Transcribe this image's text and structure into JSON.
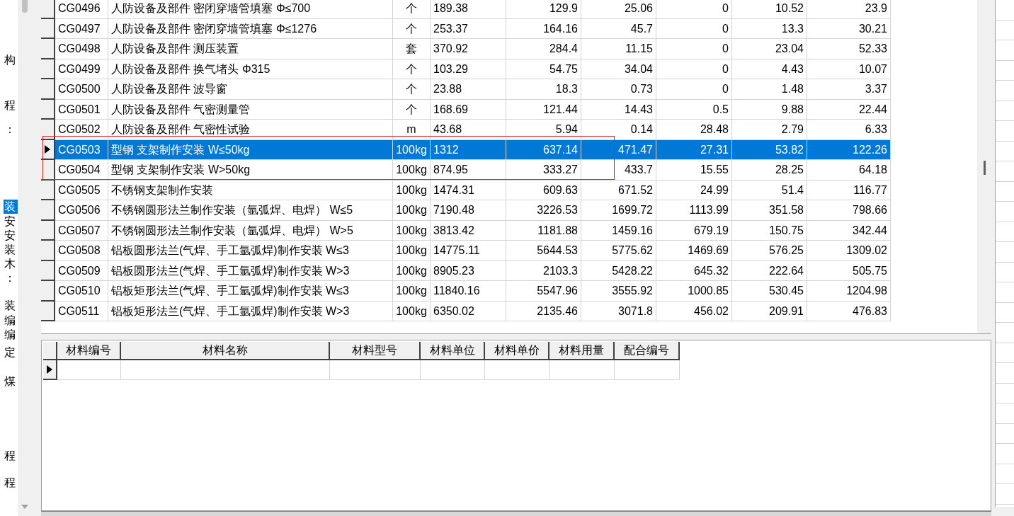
{
  "tree_items": [
    {
      "label": "构",
      "selected": false
    },
    {
      "label": "程",
      "selected": false
    },
    {
      "label": "：",
      "selected": false
    },
    {
      "label": "装",
      "selected": true
    },
    {
      "label": "安",
      "selected": false
    },
    {
      "label": "安",
      "selected": false
    },
    {
      "label": "装",
      "selected": false
    },
    {
      "label": "木",
      "selected": false
    },
    {
      "label": "：",
      "selected": false
    },
    {
      "label": "装",
      "selected": false
    },
    {
      "label": "编",
      "selected": false
    },
    {
      "label": "编",
      "selected": false
    },
    {
      "label": "定",
      "selected": false
    },
    {
      "label": "煤",
      "selected": false
    },
    {
      "label": "程",
      "selected": false
    },
    {
      "label": "程",
      "selected": false
    }
  ],
  "quota_table": {
    "rows": [
      {
        "selected": false,
        "cells": [
          "CG0496",
          "人防设备及部件 密闭穿墙管填塞 Φ≤700",
          "个",
          "189.38",
          "129.9",
          "25.06",
          "0",
          "10.52",
          "23.9"
        ]
      },
      {
        "selected": false,
        "cells": [
          "CG0497",
          "人防设备及部件 密闭穿墙管填塞 Φ≤1276",
          "个",
          "253.37",
          "164.16",
          "45.7",
          "0",
          "13.3",
          "30.21"
        ]
      },
      {
        "selected": false,
        "cells": [
          "CG0498",
          "人防设备及部件 测压装置",
          "套",
          "370.92",
          "284.4",
          "11.15",
          "0",
          "23.04",
          "52.33"
        ]
      },
      {
        "selected": false,
        "cells": [
          "CG0499",
          "人防设备及部件 换气堵头 Φ315",
          "个",
          "103.29",
          "54.75",
          "34.04",
          "0",
          "4.43",
          "10.07"
        ]
      },
      {
        "selected": false,
        "cells": [
          "CG0500",
          "人防设备及部件 波导窗",
          "个",
          "23.88",
          "18.3",
          "0.73",
          "0",
          "1.48",
          "3.37"
        ]
      },
      {
        "selected": false,
        "cells": [
          "CG0501",
          "人防设备及部件 气密测量管",
          "个",
          "168.69",
          "121.44",
          "14.43",
          "0.5",
          "9.88",
          "22.44"
        ]
      },
      {
        "selected": false,
        "cells": [
          "CG0502",
          "人防设备及部件 气密性试验",
          "m",
          "43.68",
          "5.94",
          "0.14",
          "28.48",
          "2.79",
          "6.33"
        ]
      },
      {
        "selected": true,
        "cells": [
          "CG0503",
          "型钢 支架制作安装 W≤50kg",
          "100kg",
          "1312",
          "637.14",
          "471.47",
          "27.31",
          "53.82",
          "122.26"
        ]
      },
      {
        "selected": false,
        "cells": [
          "CG0504",
          "型钢 支架制作安装 W>50kg",
          "100kg",
          "874.95",
          "333.27",
          "433.7",
          "15.55",
          "28.25",
          "64.18"
        ]
      },
      {
        "selected": false,
        "cells": [
          "CG0505",
          "不锈钢支架制作安装",
          "100kg",
          "1474.31",
          "609.63",
          "671.52",
          "24.99",
          "51.4",
          "116.77"
        ]
      },
      {
        "selected": false,
        "cells": [
          "CG0506",
          "不锈钢圆形法兰制作安装（氩弧焊、电焊） W≤5",
          "100kg",
          "7190.48",
          "3226.53",
          "1699.72",
          "1113.99",
          "351.58",
          "798.66"
        ]
      },
      {
        "selected": false,
        "cells": [
          "CG0507",
          "不锈钢圆形法兰制作安装（氩弧焊、电焊） W>5",
          "100kg",
          "3813.42",
          "1181.88",
          "1459.16",
          "679.19",
          "150.75",
          "342.44"
        ]
      },
      {
        "selected": false,
        "cells": [
          "CG0508",
          "铝板圆形法兰(气焊、手工氩弧焊)制作安装 W≤3",
          "100kg",
          "14775.11",
          "5644.53",
          "5775.62",
          "1469.69",
          "576.25",
          "1309.02"
        ]
      },
      {
        "selected": false,
        "cells": [
          "CG0509",
          "铝板圆形法兰(气焊、手工氩弧焊)制作安装 W>3",
          "100kg",
          "8905.23",
          "2103.3",
          "5428.22",
          "645.32",
          "222.64",
          "505.75"
        ]
      },
      {
        "selected": false,
        "cells": [
          "CG0510",
          "铝板矩形法兰(气焊、手工氩弧焊)制作安装 W≤3",
          "100kg",
          "11840.16",
          "5547.96",
          "3555.92",
          "1000.85",
          "530.45",
          "1204.98"
        ]
      },
      {
        "selected": false,
        "cells": [
          "CG0511",
          "铝板矩形法兰(气焊、手工氩弧焊)制作安装 W>3",
          "100kg",
          "6350.02",
          "2135.46",
          "3071.8",
          "456.02",
          "209.91",
          "476.83"
        ]
      }
    ]
  },
  "materials_table": {
    "columns": [
      "材料编号",
      "材料名称",
      "材料型号",
      "材料单位",
      "材料单价",
      "材料用量",
      "配合编号"
    ],
    "rows": [
      {
        "selected": true
      }
    ]
  }
}
